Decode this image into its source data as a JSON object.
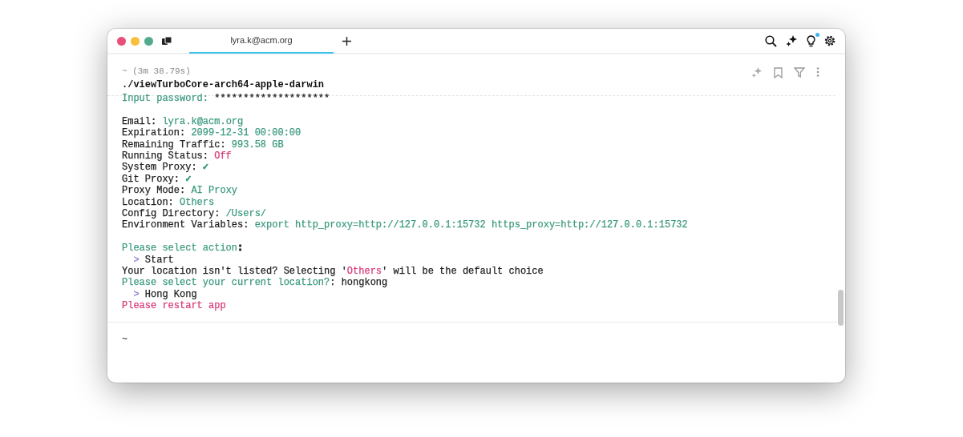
{
  "tab": {
    "label": "lyra.k@acm.org",
    "selected": true
  },
  "block": {
    "meta": "~ (3m 38.79s)",
    "command": "./viewTurboCore-arch64-apple-darwin"
  },
  "notification_dot": true,
  "output": [
    {
      "spaced": false,
      "segments": [
        {
          "text": "Input password: ",
          "color": "#3d9a80"
        },
        {
          "text": "********************",
          "color": "#222222"
        }
      ]
    },
    {
      "spaced": true,
      "segments": [
        {
          "text": "Email: ",
          "color": "#222222"
        },
        {
          "text": "lyra.k@acm.org",
          "color": "#3d9a80"
        }
      ]
    },
    {
      "spaced": false,
      "segments": [
        {
          "text": "Expiration: ",
          "color": "#222222"
        },
        {
          "text": "2099-12-31 00:00:00",
          "color": "#3d9a80"
        }
      ]
    },
    {
      "spaced": false,
      "segments": [
        {
          "text": "Remaining Traffic: ",
          "color": "#222222"
        },
        {
          "text": "993.58 GB",
          "color": "#3d9a80"
        }
      ]
    },
    {
      "spaced": false,
      "segments": [
        {
          "text": "Running Status: ",
          "color": "#222222"
        },
        {
          "text": "Off",
          "color": "#d83a7a"
        }
      ]
    },
    {
      "spaced": false,
      "segments": [
        {
          "text": "System Proxy: ",
          "color": "#222222"
        },
        {
          "text": "✓",
          "color": "#3d9a80"
        }
      ]
    },
    {
      "spaced": false,
      "segments": [
        {
          "text": "Git Proxy: ",
          "color": "#222222"
        },
        {
          "text": "✓",
          "color": "#3d9a80"
        }
      ]
    },
    {
      "spaced": false,
      "segments": [
        {
          "text": "Proxy Mode: ",
          "color": "#222222"
        },
        {
          "text": "AI Proxy",
          "color": "#3d9a80"
        }
      ]
    },
    {
      "spaced": false,
      "segments": [
        {
          "text": "Location: ",
          "color": "#222222"
        },
        {
          "text": "Others",
          "color": "#3d9a80"
        }
      ]
    },
    {
      "spaced": false,
      "segments": [
        {
          "text": "Config Directory: ",
          "color": "#222222"
        },
        {
          "text": "/Users/",
          "color": "#3d9a80"
        }
      ]
    },
    {
      "spaced": false,
      "segments": [
        {
          "text": "Environment Variables: ",
          "color": "#222222"
        },
        {
          "text": "export http_proxy=http://127.0.0.1:15732 https_proxy=http://127.0.0.1:15732",
          "color": "#3d9a80"
        }
      ]
    },
    {
      "spaced": true,
      "segments": [
        {
          "text": "Please select action",
          "color": "#3d9a80"
        },
        {
          "text": ":",
          "color": "#222222"
        }
      ]
    },
    {
      "spaced": false,
      "segments": [
        {
          "text": "  > ",
          "color": "#8a7fd8"
        },
        {
          "text": "Start",
          "color": "#222222"
        }
      ]
    },
    {
      "spaced": false,
      "segments": [
        {
          "text": "Your location isn't listed? Selecting '",
          "color": "#222222"
        },
        {
          "text": "Others",
          "color": "#d83a7a"
        },
        {
          "text": "' will be the default choice",
          "color": "#222222"
        }
      ]
    },
    {
      "spaced": false,
      "segments": [
        {
          "text": "Please select your current location?",
          "color": "#3d9a80"
        },
        {
          "text": ": hongkong",
          "color": "#222222"
        }
      ]
    },
    {
      "spaced": false,
      "segments": [
        {
          "text": "  > ",
          "color": "#8a7fd8"
        },
        {
          "text": "Hong Kong",
          "color": "#222222"
        }
      ]
    },
    {
      "spaced": false,
      "segments": [
        {
          "text": "Please restart app",
          "color": "#d83a7a"
        }
      ]
    }
  ],
  "prompt": "~"
}
